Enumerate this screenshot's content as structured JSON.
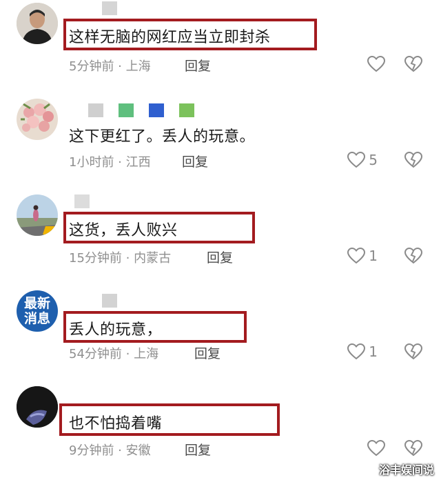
{
  "comments": [
    {
      "text": "这样无脑的网红应当立即封杀",
      "time": "5分钟前",
      "location": "上海",
      "reply": "回复",
      "likes": ""
    },
    {
      "text": "这下更红了。丢人的玩意。",
      "time": "1小时前",
      "location": "江西",
      "reply": "回复",
      "likes": "5"
    },
    {
      "text": "这货，丢人败兴",
      "time": "15分钟前",
      "location": "内蒙古",
      "reply": "回复",
      "likes": "1"
    },
    {
      "text": "丢人的玩意，",
      "time": "54分钟前",
      "location": "上海",
      "reply": "回复",
      "likes": "1"
    },
    {
      "text": "也不怕捣着嘴",
      "time": "9分钟前",
      "location": "安徽",
      "reply": "回复",
      "likes": ""
    }
  ],
  "avatar4_text": {
    "line1": "最新",
    "line2": "消息"
  },
  "meta_sep": " · ",
  "icons": {
    "like": "heart-outline-icon",
    "dislike": "broken-heart-icon"
  },
  "colors": {
    "highlight": "#a31b1f",
    "meta": "#8f8f8f",
    "text": "#1a1a1a"
  },
  "watermark": "浴丰娱间说"
}
